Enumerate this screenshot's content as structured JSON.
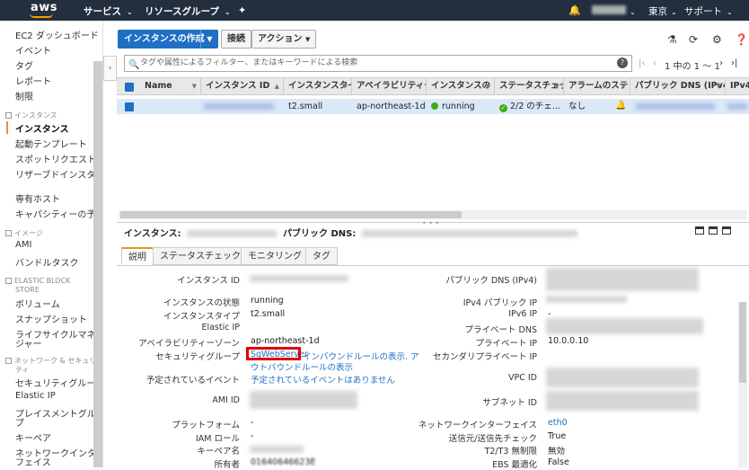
{
  "topbar": {
    "logo": "aws",
    "services": "サービス",
    "resource_groups": "リソースグループ",
    "region": "東京",
    "support": "サポート"
  },
  "sidebar": {
    "items": [
      {
        "label": "EC2 ダッシュボード"
      },
      {
        "label": "イベント"
      },
      {
        "label": "タグ"
      },
      {
        "label": "レポート"
      },
      {
        "label": "制限"
      }
    ],
    "sections": [
      {
        "title": "インスタンス",
        "items": [
          "インスタンス",
          "起動テンプレート",
          "スポットリクエスト",
          "リザーブドインスタンス",
          "専有ホスト",
          "キャパシティーの予約"
        ]
      },
      {
        "title": "イメージ",
        "items": [
          "AMI",
          "バンドルタスク"
        ]
      },
      {
        "title_line1": "ELASTIC BLOCK",
        "title_line2": "STORE",
        "items": [
          "ボリューム",
          "スナップショット",
          "ライフサイクルマネー",
          "ジャー"
        ]
      },
      {
        "title_line1": "ネットワーク & セキュリ",
        "title_line2": "ティ",
        "items": [
          "セキュリティグループ",
          "Elastic IP",
          "プレイスメントグルー",
          "プ",
          "キーペア",
          "ネットワークインター",
          "フェイス"
        ]
      }
    ]
  },
  "toolbar": {
    "launch": "インスタンスの作成",
    "connect": "接続",
    "actions": "アクション"
  },
  "search": {
    "placeholder": "タグや属性によるフィルター、またはキーワードによる検索"
  },
  "pager": {
    "text": "1 中の 1 ～ 1"
  },
  "table": {
    "columns": [
      "Name",
      "インスタンス ID",
      "インスタンスタイ",
      "アベイラビリティー",
      "インスタンスの",
      "ステータスチェッ",
      "アラームのステ",
      "パブリック DNS (IPv4)",
      "IPv4"
    ],
    "row": {
      "type": "t2.small",
      "az": "ap-northeast-1d",
      "state": "running",
      "status": "2/2 のチェ...",
      "alarm": "なし"
    }
  },
  "detail": {
    "instance_label": "インスタンス:",
    "dns_label": "パブリック DNS:",
    "tabs": [
      "説明",
      "ステータスチェック",
      "モニタリング",
      "タグ"
    ],
    "left": [
      {
        "label": "インスタンス ID",
        "value": ""
      },
      {
        "label": "インスタンスの状態",
        "value": "running"
      },
      {
        "label": "インスタンスタイプ",
        "value": "t2.small"
      },
      {
        "label": "Elastic IP",
        "value": ""
      },
      {
        "label": "アベイラビリティーゾーン",
        "value": "ap-northeast-1d"
      },
      {
        "label": "セキュリティグループ",
        "value": "SgWebServer"
      },
      {
        "label": "予定されているイベント",
        "value": "予定されているイベントはありません"
      },
      {
        "label": "AMI ID",
        "value": ""
      },
      {
        "label": "プラットフォーム",
        "value": "-"
      },
      {
        "label": "IAM ロール",
        "value": "-"
      },
      {
        "label": "キーペア名",
        "value": ""
      },
      {
        "label": "所有者",
        "value": "01640646623E"
      }
    ],
    "sg_links_1": "インバウンドルールの表示. ア",
    "sg_links_2": "ウトバウンドルールの表示",
    "right": [
      {
        "label": "パブリック DNS (IPv4)",
        "value": ""
      },
      {
        "label": "IPv4 パブリック IP",
        "value": ""
      },
      {
        "label": "IPv6 IP",
        "value": "-"
      },
      {
        "label": "プライベート DNS",
        "value": ""
      },
      {
        "label": "プライベート IP",
        "value": "10.0.0.10"
      },
      {
        "label": "セカンダリプライベート IP",
        "value": ""
      },
      {
        "label": "VPC ID",
        "value": ""
      },
      {
        "label": "サブネット ID",
        "value": ""
      },
      {
        "label": "ネットワークインターフェイス",
        "value": "eth0"
      },
      {
        "label": "送信元/送信先チェック",
        "value": "True"
      },
      {
        "label": "T2/T3 無制限",
        "value": "無効"
      },
      {
        "label": "EBS 最適化",
        "value": "False"
      }
    ]
  }
}
